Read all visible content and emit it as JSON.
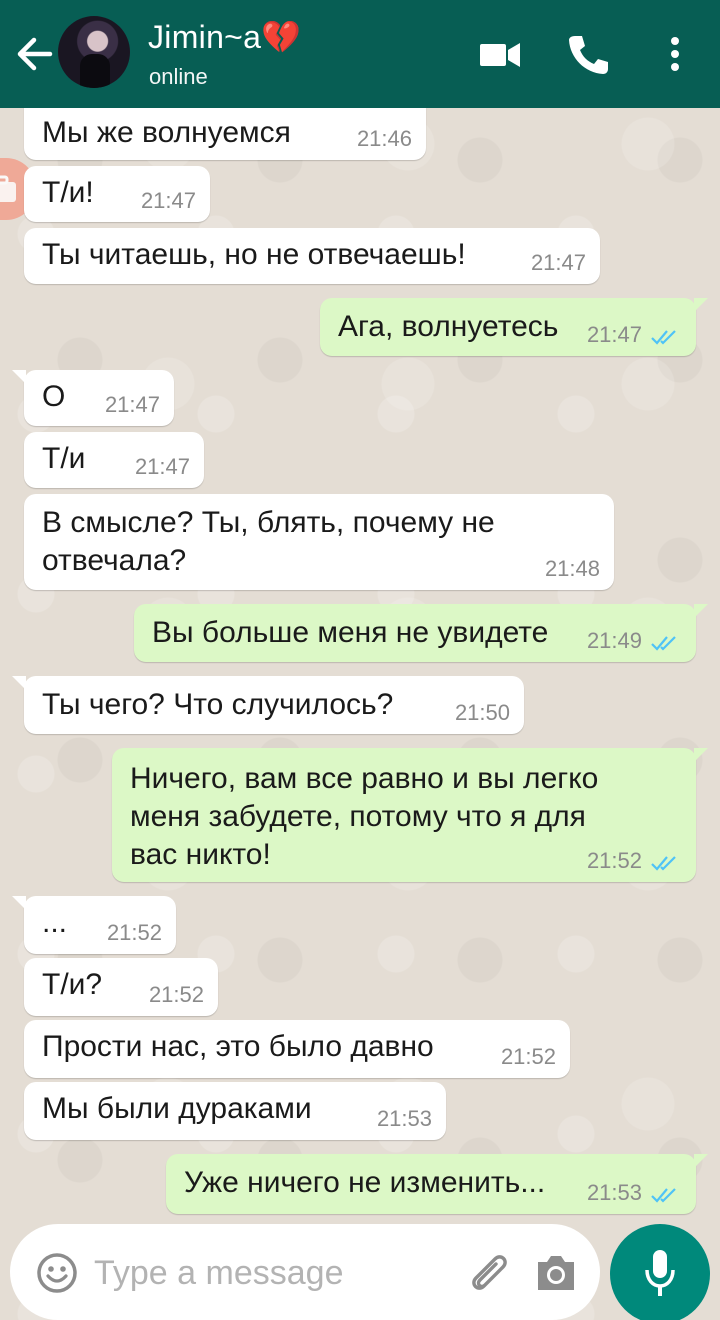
{
  "header": {
    "contact_name": "Jimin~a💔",
    "status": "online"
  },
  "messages": [
    {
      "text": "Мы же волнуемся",
      "time": "21:46",
      "dir": "in"
    },
    {
      "text": "Т/и!",
      "time": "21:47",
      "dir": "in"
    },
    {
      "text": "Ты читаешь, но не отвечаешь!",
      "time": "21:47",
      "dir": "in"
    },
    {
      "text": "Ага, волнуетесь",
      "time": "21:47",
      "dir": "out"
    },
    {
      "text": "О",
      "time": "21:47",
      "dir": "in"
    },
    {
      "text": "Т/и",
      "time": "21:47",
      "dir": "in"
    },
    {
      "text": "В смысле? Ты, блять, почему не\nотвечала?",
      "time": "21:48",
      "dir": "in"
    },
    {
      "text": "Вы больше меня не увидете",
      "time": "21:49",
      "dir": "out"
    },
    {
      "text": "Ты чего? Что случилось?",
      "time": "21:50",
      "dir": "in"
    },
    {
      "text": "Ничего, вам все равно и вы легко\nменя забудете, потому что я для\nвас никто!",
      "time": "21:52",
      "dir": "out"
    },
    {
      "text": "...",
      "time": "21:52",
      "dir": "in"
    },
    {
      "text": "Т/и?",
      "time": "21:52",
      "dir": "in"
    },
    {
      "text": "Прости нас, это было давно",
      "time": "21:52",
      "dir": "in"
    },
    {
      "text": "Мы были дураками",
      "time": "21:53",
      "dir": "in"
    },
    {
      "text": "Уже ничего не изменить...",
      "time": "21:53",
      "dir": "out"
    }
  ],
  "input": {
    "placeholder": "Type a message"
  },
  "colors": {
    "header": "#075e54",
    "incoming_bubble": "#ffffff",
    "outgoing_bubble": "#dcf8c6",
    "read_ticks": "#4fc3f7",
    "mic_button": "#00897b"
  },
  "icons": [
    "back-arrow-icon",
    "video-call-icon",
    "phone-icon",
    "more-vert-icon",
    "emoji-icon",
    "attach-icon",
    "camera-icon",
    "mic-icon",
    "double-check-icon"
  ]
}
